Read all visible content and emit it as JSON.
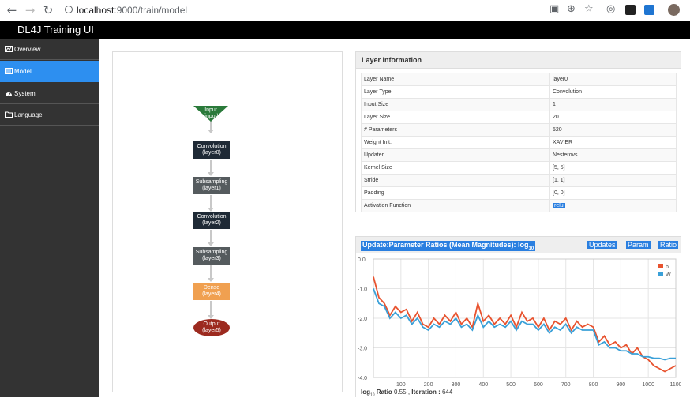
{
  "browser": {
    "url_host": "localhost",
    "url_path": ":9000/train/model"
  },
  "app": {
    "title": "DL4J Training UI"
  },
  "sidebar": {
    "items": [
      {
        "label": "Overview",
        "icon": "chart-icon",
        "active": false
      },
      {
        "label": "Model",
        "icon": "layers-icon",
        "active": true
      },
      {
        "label": "System",
        "icon": "gauge-icon",
        "active": false
      },
      {
        "label": "Language",
        "icon": "folder-icon",
        "active": false
      }
    ]
  },
  "graph": {
    "nodes": [
      {
        "name": "Input",
        "sub": "(input)",
        "shape": "triangle",
        "color": "#2a7a3a"
      },
      {
        "name": "Convolution",
        "sub": "(layer0)",
        "shape": "rect",
        "color": "#1f2a36"
      },
      {
        "name": "Subsampling",
        "sub": "(layer1)",
        "shape": "rect",
        "color": "#555b5e"
      },
      {
        "name": "Convolution",
        "sub": "(layer2)",
        "shape": "rect",
        "color": "#1f2a36"
      },
      {
        "name": "Subsampling",
        "sub": "(layer3)",
        "shape": "rect",
        "color": "#555b5e"
      },
      {
        "name": "Dense",
        "sub": "(layer4)",
        "shape": "rect",
        "color": "#f0a050"
      },
      {
        "name": "Output",
        "sub": "(layer5)",
        "shape": "ellipse",
        "color": "#9c2a1f"
      }
    ]
  },
  "layer_info": {
    "title": "Layer Information",
    "rows": [
      {
        "key": "Layer Name",
        "value": "layer0"
      },
      {
        "key": "Layer Type",
        "value": "Convolution"
      },
      {
        "key": "Input Size",
        "value": "1"
      },
      {
        "key": "Layer Size",
        "value": "20"
      },
      {
        "key": "# Parameters",
        "value": "520"
      },
      {
        "key": "Weight Init.",
        "value": "XAVIER"
      },
      {
        "key": "Updater",
        "value": "Nesterovs"
      },
      {
        "key": "Kernel Size",
        "value": "[5, 5]"
      },
      {
        "key": "Stride",
        "value": "[1, 1]"
      },
      {
        "key": "Padding",
        "value": "[0, 0]"
      },
      {
        "key": "Activation Function",
        "value": "relu",
        "highlighted": true
      }
    ]
  },
  "chart_panel": {
    "title_main": "Update:Parameter Ratios (Mean Magnitudes): log",
    "title_sub": "10",
    "tabs": [
      "Updates",
      "Param",
      "Ratio"
    ],
    "footer": {
      "log_label": "log",
      "log_sub": "10",
      "ratio_label": "Ratio",
      "ratio_value": "0.55",
      "iteration_label": "Iteration :",
      "iteration_value": "644"
    }
  },
  "chart_data": {
    "type": "line",
    "ylim": [
      -4.0,
      0.0
    ],
    "xlim": [
      0,
      1100
    ],
    "yticks": [
      "0.0",
      "-1.0",
      "-2.0",
      "-3.0",
      "-4.0"
    ],
    "xticks": [
      "100",
      "200",
      "300",
      "400",
      "500",
      "600",
      "700",
      "800",
      "900",
      "1000",
      "1100"
    ],
    "grid": true,
    "legend_position": "top-right",
    "x": [
      0,
      20,
      40,
      60,
      80,
      100,
      120,
      140,
      160,
      180,
      200,
      220,
      240,
      260,
      280,
      300,
      320,
      340,
      360,
      380,
      400,
      420,
      440,
      460,
      480,
      500,
      520,
      540,
      560,
      580,
      600,
      620,
      640,
      660,
      680,
      700,
      720,
      740,
      760,
      780,
      800,
      820,
      840,
      860,
      880,
      900,
      920,
      940,
      960,
      980,
      1000,
      1020,
      1040,
      1060,
      1080,
      1100
    ],
    "series": [
      {
        "name": "b",
        "color": "#e8532f",
        "values": [
          -0.6,
          -1.3,
          -1.5,
          -1.9,
          -1.6,
          -1.8,
          -1.7,
          -2.1,
          -1.8,
          -2.2,
          -2.3,
          -2.0,
          -2.2,
          -1.9,
          -2.1,
          -1.8,
          -2.2,
          -2.0,
          -2.3,
          -1.5,
          -2.1,
          -1.9,
          -2.2,
          -2.0,
          -2.2,
          -1.9,
          -2.3,
          -1.8,
          -2.1,
          -2.0,
          -2.3,
          -2.0,
          -2.4,
          -2.1,
          -2.2,
          -2.0,
          -2.4,
          -2.1,
          -2.3,
          -2.2,
          -2.3,
          -2.8,
          -2.6,
          -2.9,
          -2.8,
          -3.0,
          -2.9,
          -3.2,
          -3.0,
          -3.3,
          -3.4,
          -3.6,
          -3.7,
          -3.8,
          -3.7,
          -3.6
        ]
      },
      {
        "name": "W",
        "color": "#3aa0d8",
        "values": [
          -1.0,
          -1.5,
          -1.6,
          -2.0,
          -1.8,
          -2.0,
          -1.9,
          -2.2,
          -2.0,
          -2.3,
          -2.4,
          -2.2,
          -2.3,
          -2.1,
          -2.2,
          -2.0,
          -2.3,
          -2.2,
          -2.4,
          -1.9,
          -2.3,
          -2.1,
          -2.3,
          -2.2,
          -2.3,
          -2.1,
          -2.4,
          -2.1,
          -2.2,
          -2.2,
          -2.4,
          -2.2,
          -2.5,
          -2.3,
          -2.4,
          -2.2,
          -2.5,
          -2.3,
          -2.4,
          -2.4,
          -2.4,
          -2.9,
          -2.8,
          -3.0,
          -3.0,
          -3.1,
          -3.1,
          -3.2,
          -3.2,
          -3.3,
          -3.3,
          -3.35,
          -3.35,
          -3.4,
          -3.35,
          -3.35
        ]
      }
    ]
  }
}
